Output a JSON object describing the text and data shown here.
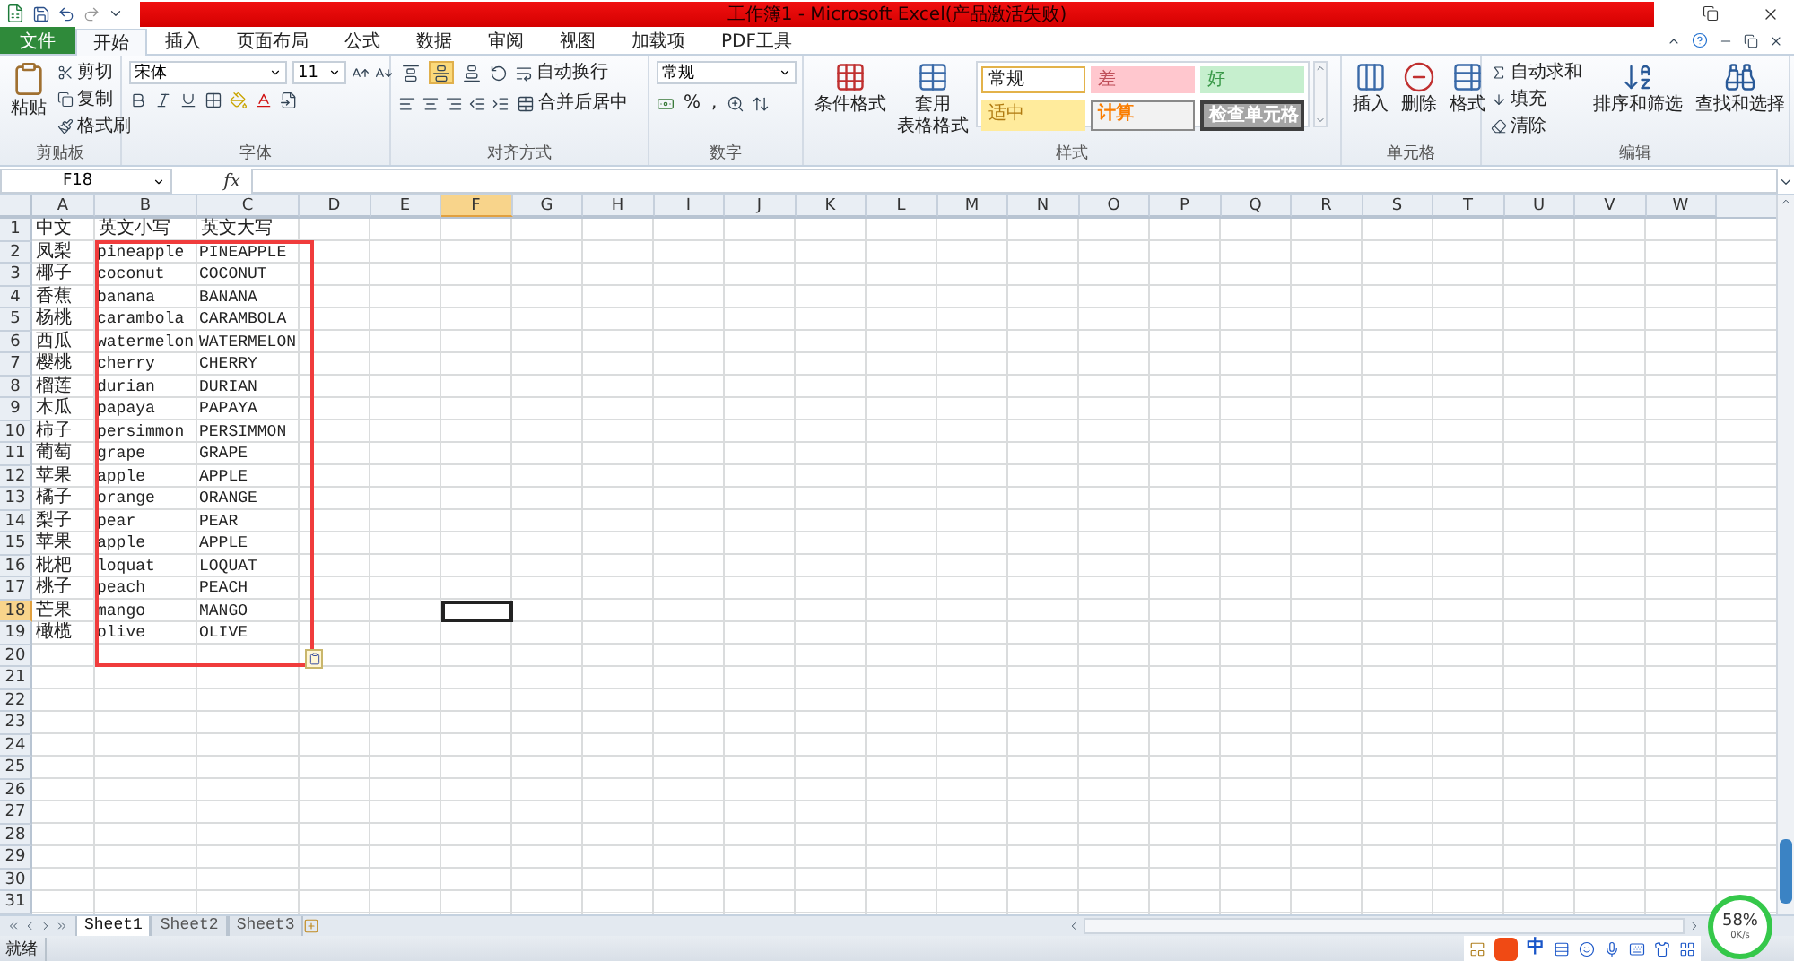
{
  "window": {
    "title": "工作簿1 - Microsoft Excel(产品激活失败)"
  },
  "tabs": [
    {
      "label": "文件",
      "kind": "file",
      "selected": false
    },
    {
      "label": "开始",
      "kind": "tab",
      "selected": true
    },
    {
      "label": "插入",
      "kind": "tab",
      "selected": false
    },
    {
      "label": "页面布局",
      "kind": "tab",
      "selected": false
    },
    {
      "label": "公式",
      "kind": "tab",
      "selected": false
    },
    {
      "label": "数据",
      "kind": "tab",
      "selected": false
    },
    {
      "label": "审阅",
      "kind": "tab",
      "selected": false
    },
    {
      "label": "视图",
      "kind": "tab",
      "selected": false
    },
    {
      "label": "加载项",
      "kind": "tab",
      "selected": false
    },
    {
      "label": "PDF工具",
      "kind": "tab",
      "selected": false
    }
  ],
  "ribbon": {
    "clipboard": {
      "label": "剪贴板",
      "paste": "粘贴",
      "items": [
        "剪切",
        "复制",
        "格式刷"
      ]
    },
    "font": {
      "label": "字体",
      "font_name": "宋体",
      "font_size": "11"
    },
    "alignment": {
      "label": "对齐方式",
      "wrap": "自动换行",
      "merge": "合并后居中"
    },
    "number": {
      "label": "数字",
      "format": "常规",
      "percent": "%",
      "comma": ","
    },
    "styles": {
      "label": "样式",
      "conditional": "条件格式",
      "table_lines": [
        "套用",
        "表格格式"
      ],
      "cell_styles": [
        {
          "label": "常规",
          "kind": "normal",
          "selected": true
        },
        {
          "label": "差",
          "kind": "bad",
          "selected": false
        },
        {
          "label": "好",
          "kind": "good",
          "selected": false
        },
        {
          "label": "适中",
          "kind": "neutral",
          "selected": false
        },
        {
          "label": "计算",
          "kind": "calculation",
          "selected": false
        },
        {
          "label": "检查单元格",
          "kind": "check",
          "selected": false
        }
      ]
    },
    "cells": {
      "label": "单元格",
      "buttons": [
        "插入",
        "删除",
        "格式"
      ]
    },
    "editing": {
      "label": "编辑",
      "items": [
        "自动求和",
        "填充",
        "清除"
      ],
      "big": [
        "排序和筛选",
        "查找和选择"
      ]
    }
  },
  "formula_bar": {
    "name_box": "F18",
    "fx": "fx"
  },
  "columns": [
    {
      "label": "A",
      "selected": false
    },
    {
      "label": "B",
      "selected": false
    },
    {
      "label": "C",
      "selected": false
    },
    {
      "label": "D",
      "selected": false
    },
    {
      "label": "E",
      "selected": false
    },
    {
      "label": "F",
      "selected": true
    },
    {
      "label": "G",
      "selected": false
    },
    {
      "label": "H",
      "selected": false
    },
    {
      "label": "I",
      "selected": false
    },
    {
      "label": "J",
      "selected": false
    },
    {
      "label": "K",
      "selected": false
    },
    {
      "label": "L",
      "selected": false
    },
    {
      "label": "M",
      "selected": false
    },
    {
      "label": "N",
      "selected": false
    },
    {
      "label": "O",
      "selected": false
    },
    {
      "label": "P",
      "selected": false
    },
    {
      "label": "Q",
      "selected": false
    },
    {
      "label": "R",
      "selected": false
    },
    {
      "label": "S",
      "selected": false
    },
    {
      "label": "T",
      "selected": false
    },
    {
      "label": "U",
      "selected": false
    },
    {
      "label": "V",
      "selected": false
    },
    {
      "label": "W",
      "selected": false
    }
  ],
  "rows": [
    {
      "number": "1",
      "selected": false,
      "cells": [
        "中文",
        "英文小写",
        "英文大写"
      ]
    },
    {
      "number": "2",
      "selected": false,
      "cells": [
        "凤梨",
        "pineapple",
        "PINEAPPLE"
      ]
    },
    {
      "number": "3",
      "selected": false,
      "cells": [
        "椰子",
        "coconut",
        "COCONUT"
      ]
    },
    {
      "number": "4",
      "selected": false,
      "cells": [
        "香蕉",
        "banana",
        "BANANA"
      ]
    },
    {
      "number": "5",
      "selected": false,
      "cells": [
        "杨桃",
        "carambola",
        "CARAMBOLA"
      ]
    },
    {
      "number": "6",
      "selected": false,
      "cells": [
        "西瓜",
        "watermelon",
        "WATERMELON"
      ]
    },
    {
      "number": "7",
      "selected": false,
      "cells": [
        "樱桃",
        "cherry",
        "CHERRY"
      ]
    },
    {
      "number": "8",
      "selected": false,
      "cells": [
        "榴莲",
        "durian",
        "DURIAN"
      ]
    },
    {
      "number": "9",
      "selected": false,
      "cells": [
        "木瓜",
        "papaya",
        "PAPAYA"
      ]
    },
    {
      "number": "10",
      "selected": false,
      "cells": [
        "柿子",
        "persimmon",
        "PERSIMMON"
      ]
    },
    {
      "number": "11",
      "selected": false,
      "cells": [
        "葡萄",
        "grape",
        "GRAPE"
      ]
    },
    {
      "number": "12",
      "selected": false,
      "cells": [
        "苹果",
        "apple",
        "APPLE"
      ]
    },
    {
      "number": "13",
      "selected": false,
      "cells": [
        "橘子",
        "orange",
        "ORANGE"
      ]
    },
    {
      "number": "14",
      "selected": false,
      "cells": [
        "梨子",
        "pear",
        "PEAR"
      ]
    },
    {
      "number": "15",
      "selected": false,
      "cells": [
        "苹果",
        "apple",
        "APPLE"
      ]
    },
    {
      "number": "16",
      "selected": false,
      "cells": [
        "枇杷",
        "loquat",
        "LOQUAT"
      ]
    },
    {
      "number": "17",
      "selected": false,
      "cells": [
        "桃子",
        "peach",
        "PEACH"
      ]
    },
    {
      "number": "18",
      "selected": true,
      "cells": [
        "芒果",
        "mango",
        "MANGO"
      ]
    },
    {
      "number": "19",
      "selected": false,
      "cells": [
        "橄榄",
        "olive",
        "OLIVE"
      ]
    },
    {
      "number": "20",
      "selected": false
    },
    {
      "number": "21",
      "selected": false
    },
    {
      "number": "22",
      "selected": false
    },
    {
      "number": "23",
      "selected": false
    },
    {
      "number": "24",
      "selected": false
    },
    {
      "number": "25",
      "selected": false
    },
    {
      "number": "26",
      "selected": false
    },
    {
      "number": "27",
      "selected": false
    },
    {
      "number": "28",
      "selected": false
    },
    {
      "number": "29",
      "selected": false
    },
    {
      "number": "30",
      "selected": false
    },
    {
      "number": "31",
      "selected": false
    }
  ],
  "sheets": [
    {
      "label": "Sheet1",
      "selected": true
    },
    {
      "label": "Sheet2",
      "selected": false
    },
    {
      "label": "Sheet3",
      "selected": false
    }
  ],
  "status_bar": {
    "text": "就绪",
    "ime": "中",
    "speed": {
      "percent": "58%",
      "rate": "0K/s"
    }
  }
}
